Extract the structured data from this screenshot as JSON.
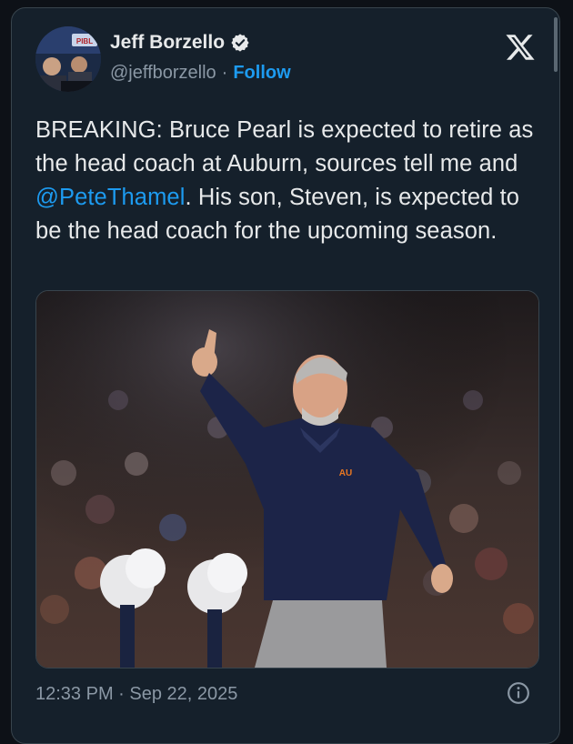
{
  "author": {
    "name": "Jeff Borzello",
    "handle": "@jeffborzello",
    "separator": "·",
    "follow_label": "Follow",
    "avatar_badge": "PIBL"
  },
  "tweet": {
    "text_before": "BREAKING: Bruce Pearl is expected to retire as the head coach at Auburn, sources tell me and ",
    "mention": "@PeteThamel",
    "text_after": ". His son, Steven, is expected to be the head coach for the upcoming season."
  },
  "media": {
    "alt": "Bruce Pearl pointing upward on the sideline in a navy Auburn quarter-zip",
    "logo_text": "AU"
  },
  "footer": {
    "timestamp": "12:33 PM · Sep 22, 2025"
  },
  "icons": {
    "verified": "verified-badge-icon",
    "x_logo": "x-logo-icon",
    "info": "info-icon"
  },
  "colors": {
    "background": "#15202b",
    "link": "#1d9bf0",
    "text": "#e7e9ea",
    "secondary": "#8b98a5"
  }
}
